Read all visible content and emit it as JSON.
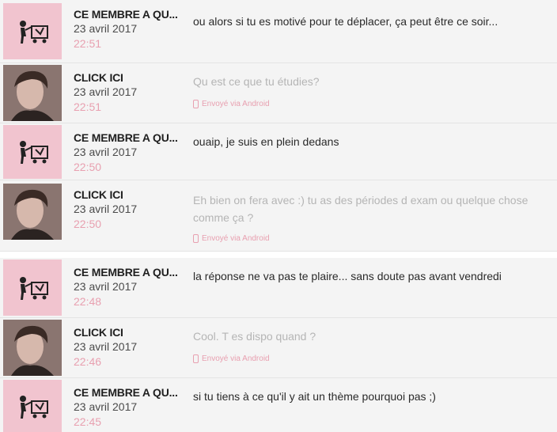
{
  "messages": [
    {
      "author": "CE MEMBRE A QU...",
      "date": "23 avril 2017",
      "time": "22:51",
      "text": "ou alors si tu es motivé pour te déplacer, ça peut être ce soir...",
      "avatar": "member-icon",
      "via": ""
    },
    {
      "author": "CLICK ICI",
      "date": "23 avril 2017",
      "time": "22:51",
      "text": "Qu est ce que tu étudies?",
      "avatar": "profile-photo",
      "via": "Envoyé via Android"
    },
    {
      "author": "CE MEMBRE A QU...",
      "date": "23 avril 2017",
      "time": "22:50",
      "text": "ouaip, je suis en plein dedans",
      "avatar": "member-icon",
      "via": ""
    },
    {
      "author": "CLICK ICI",
      "date": "23 avril 2017",
      "time": "22:50",
      "text": "Eh bien on fera avec :) tu as des périodes d exam ou quelque chose comme ça ?",
      "avatar": "profile-photo",
      "via": "Envoyé via Android"
    },
    {
      "author": "CE MEMBRE A QU...",
      "date": "23 avril 2017",
      "time": "22:48",
      "text": "la réponse ne va pas te plaire... sans doute pas avant vendredi",
      "avatar": "member-icon",
      "via": ""
    },
    {
      "author": "CLICK ICI",
      "date": "23 avril 2017",
      "time": "22:46",
      "text": "Cool. T es dispo quand ?",
      "avatar": "profile-photo",
      "via": "Envoyé via Android"
    },
    {
      "author": "CE MEMBRE A QU...",
      "date": "23 avril 2017",
      "time": "22:45",
      "text": "si tu tiens à ce qu'il y ait un thème pourquoi pas ;)",
      "avatar": "member-icon",
      "via": ""
    }
  ],
  "colors": {
    "accent_pink": "#e8a0b0",
    "avatar_pink": "#f1c4cf",
    "row_bg": "#f4f4f4"
  }
}
